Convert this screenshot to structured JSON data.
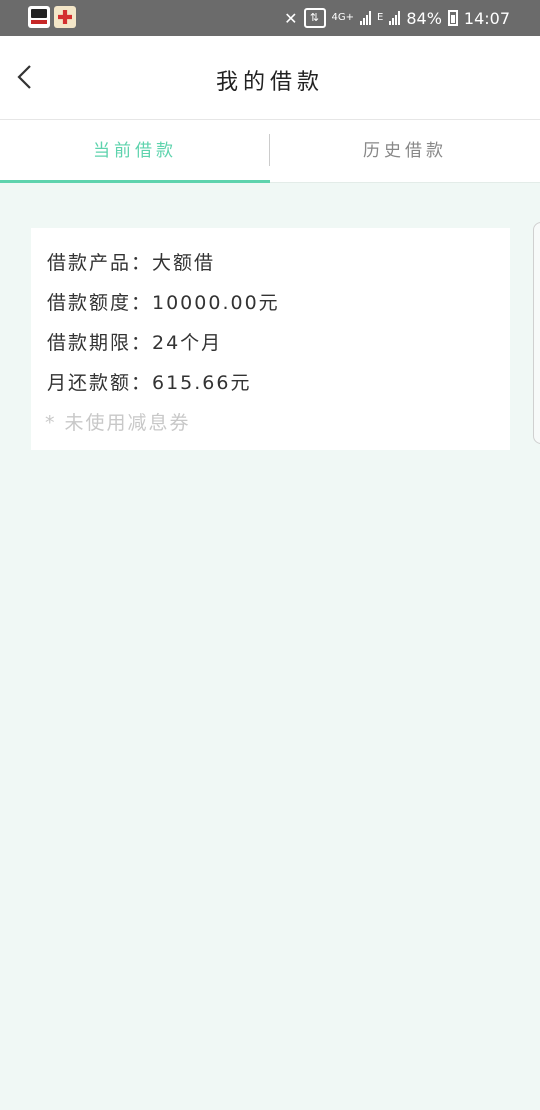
{
  "status_bar": {
    "apps": [
      "app-notification-icon-1",
      "app-notification-icon-2"
    ],
    "network": "4G+",
    "signal_sub": "E",
    "battery": "84%",
    "time": "14:07"
  },
  "header": {
    "title": "我的借款"
  },
  "tabs": [
    {
      "label": "当前借款",
      "active": true
    },
    {
      "label": "历史借款",
      "active": false
    }
  ],
  "loan": {
    "product": "借款产品：大额借",
    "amount": "借款额度：10000.00元",
    "term": "借款期限：24个月",
    "monthly": "月还款额：615.66元",
    "coupon_note": "* 未使用减息券"
  },
  "colors": {
    "accent": "#5ed3ad",
    "background": "#f0f8f5",
    "status_bar": "#6b6b6b"
  }
}
